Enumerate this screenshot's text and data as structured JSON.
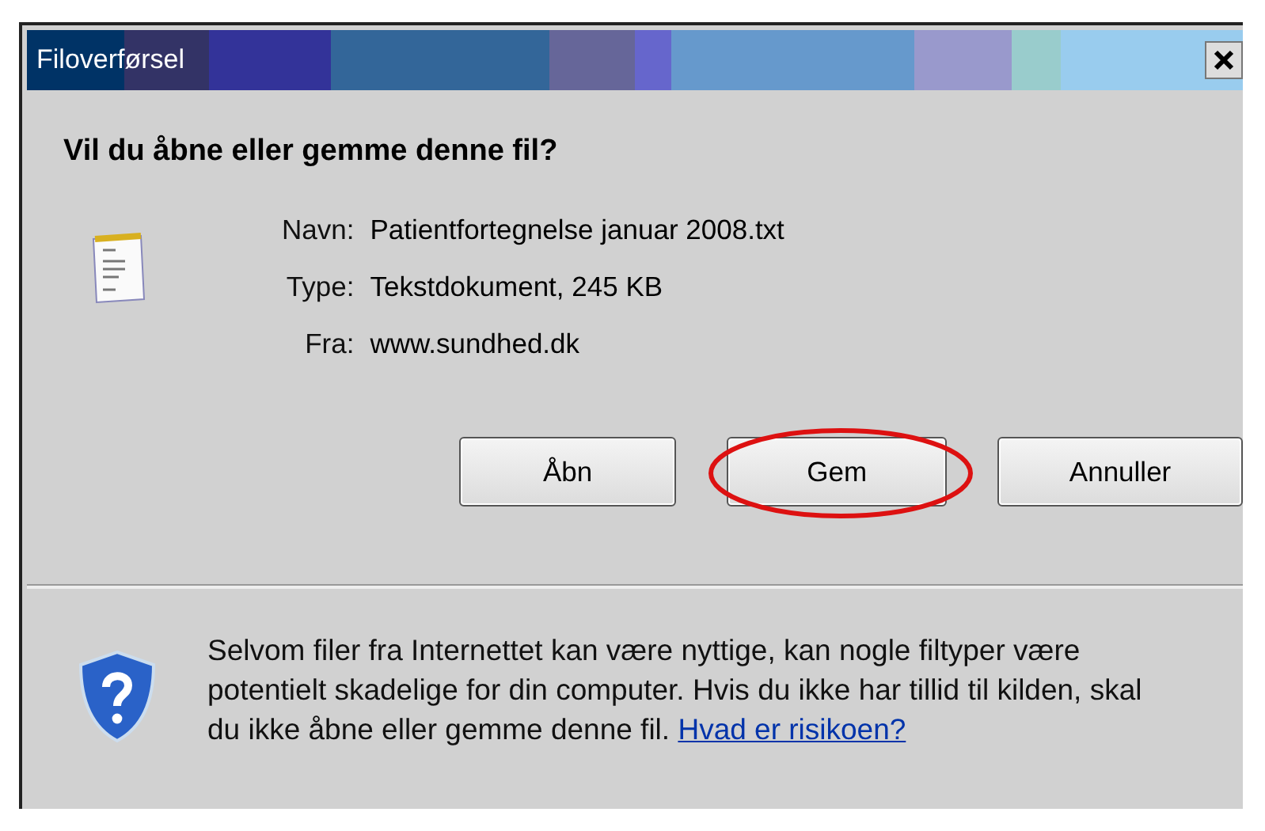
{
  "window": {
    "title": "Filoverførsel"
  },
  "heading": "Vil du åbne eller gemme denne fil?",
  "fields": [
    {
      "label": "Navn:",
      "value": "Patientfortegnelse januar 2008.txt"
    },
    {
      "label": "Type:",
      "value": "Tekstdokument, 245 KB"
    },
    {
      "label": "Fra:",
      "value": "www.sundhed.dk"
    }
  ],
  "buttons": [
    {
      "label": "Åbn",
      "highlighted": false
    },
    {
      "label": "Gem",
      "highlighted": true
    },
    {
      "label": "Annuller",
      "highlighted": false
    }
  ],
  "warning": {
    "text": "Selvom filer fra Internettet kan være nyttige, kan nogle filtyper være potentielt skadelige for din computer. Hvis du ikke har tillid til kilden, skal du ikke åbne eller gemme denne fil.",
    "link": "Hvad er risikoen?"
  }
}
